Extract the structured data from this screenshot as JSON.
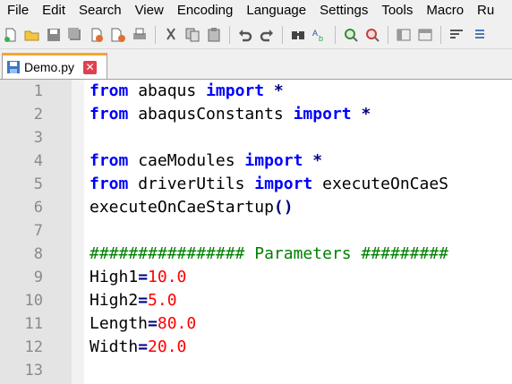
{
  "menubar": {
    "items": [
      "File",
      "Edit",
      "Search",
      "View",
      "Encoding",
      "Language",
      "Settings",
      "Tools",
      "Macro",
      "Ru"
    ]
  },
  "tab": {
    "label": "Demo.py",
    "close": "✕"
  },
  "editor": {
    "line_numbers": [
      "1",
      "2",
      "3",
      "4",
      "5",
      "6",
      "7",
      "8",
      "9",
      "10",
      "11",
      "12",
      "13"
    ],
    "lines": [
      [
        [
          "kw",
          "from"
        ],
        [
          "t",
          " abaqus "
        ],
        [
          "kw",
          "import"
        ],
        [
          "op",
          " *"
        ]
      ],
      [
        [
          "kw",
          "from"
        ],
        [
          "t",
          " abaqusConstants "
        ],
        [
          "kw",
          "import"
        ],
        [
          "op",
          " *"
        ]
      ],
      [],
      [
        [
          "kw",
          "from"
        ],
        [
          "t",
          " caeModules "
        ],
        [
          "kw",
          "import"
        ],
        [
          "op",
          " *"
        ]
      ],
      [
        [
          "kw",
          "from"
        ],
        [
          "t",
          " driverUtils "
        ],
        [
          "kw",
          "import"
        ],
        [
          "t",
          " executeOnCaeS"
        ]
      ],
      [
        [
          "t",
          "executeOnCaeStartup"
        ],
        [
          "op",
          "()"
        ]
      ],
      [],
      [
        [
          "cmt",
          "################ Parameters #########"
        ]
      ],
      [
        [
          "t",
          "High1"
        ],
        [
          "op",
          "="
        ],
        [
          "num",
          "10.0"
        ]
      ],
      [
        [
          "t",
          "High2"
        ],
        [
          "op",
          "="
        ],
        [
          "num",
          "5.0"
        ]
      ],
      [
        [
          "t",
          "Length"
        ],
        [
          "op",
          "="
        ],
        [
          "num",
          "80.0"
        ]
      ],
      [
        [
          "t",
          "Width"
        ],
        [
          "op",
          "="
        ],
        [
          "num",
          "20.0"
        ]
      ],
      []
    ]
  },
  "colors": {
    "keyword": "#0000ff",
    "number": "#ff0000",
    "comment": "#008000",
    "operator": "#000080",
    "tab_accent": "#f4a62a",
    "close": "#e04050"
  },
  "toolbar_icons": [
    "new-file-icon",
    "open-file-icon",
    "save-icon",
    "save-all-icon",
    "close-icon",
    "close-all-icon",
    "print-icon",
    "cut-icon",
    "copy-icon",
    "paste-icon",
    "undo-icon",
    "redo-icon",
    "find-icon",
    "replace-icon",
    "zoom-in-icon",
    "zoom-out-icon",
    "sync-v-icon",
    "sync-h-icon",
    "wrap-icon",
    "indent-icon"
  ]
}
